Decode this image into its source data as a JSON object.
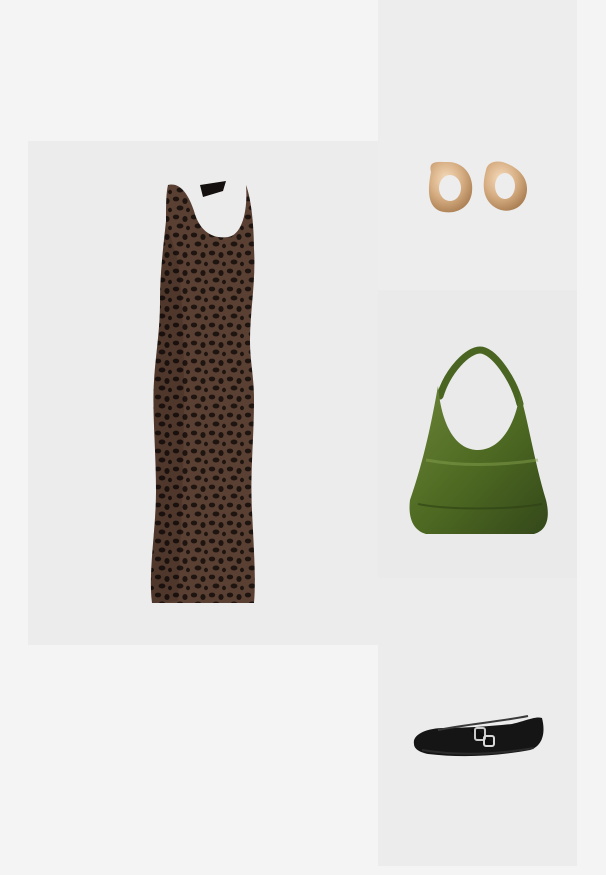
{
  "outfit": {
    "items": [
      {
        "id": "dress",
        "name": "leopard-print-halter-maxi-dress-image",
        "color": "#3a2a22"
      },
      {
        "id": "earrings",
        "name": "gold-hoop-earrings-image",
        "color": "#d8b48c"
      },
      {
        "id": "bag",
        "name": "green-shoulder-bag-image",
        "color": "#4f6a25"
      },
      {
        "id": "shoes",
        "name": "black-buckle-ballet-flats-image",
        "color": "#151515"
      }
    ]
  }
}
